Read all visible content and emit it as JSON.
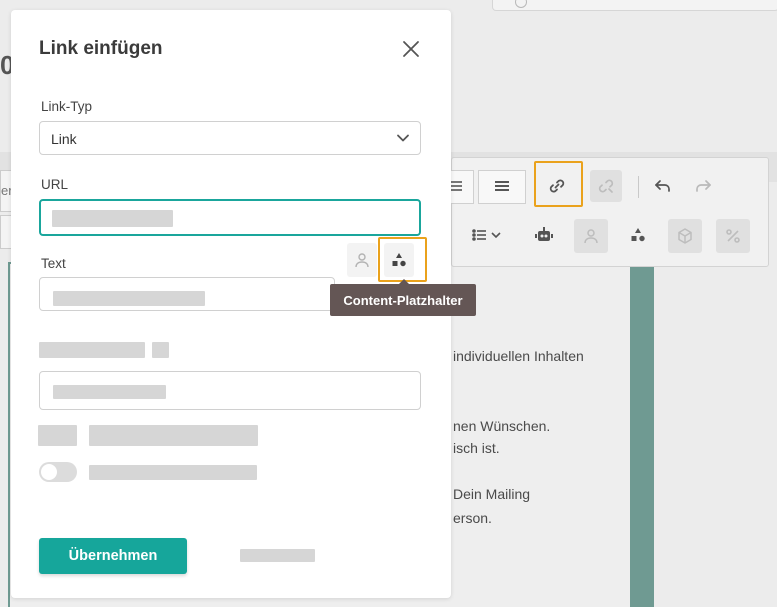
{
  "dialog": {
    "title": "Link einfügen",
    "link_type": {
      "label": "Link-Typ",
      "value": "Link"
    },
    "url": {
      "label": "URL"
    },
    "text": {
      "label": "Text"
    },
    "tooltip": "Content-Platzhalter",
    "apply_button": "Übernehmen"
  },
  "background_text": {
    "line1": "individuellen Inhalten",
    "line2": "nen Wünschen.",
    "line3": "isch ist.",
    "line4": "Dein Mailing",
    "line5": "erson.",
    "heading_fragment": "0",
    "left_input_fragment": "er"
  },
  "colors": {
    "accent": "#16a69b",
    "highlight": "#eaa21c",
    "tooltip_bg": "#645655"
  },
  "icons": [
    "close-icon",
    "chevron-down-icon",
    "link-icon",
    "unlink-icon",
    "undo-icon",
    "redo-icon",
    "align-center-icon",
    "align-justify-icon",
    "list-icon",
    "robot-icon",
    "person-icon",
    "shapes-icon",
    "cube-icon",
    "percent-icon"
  ]
}
